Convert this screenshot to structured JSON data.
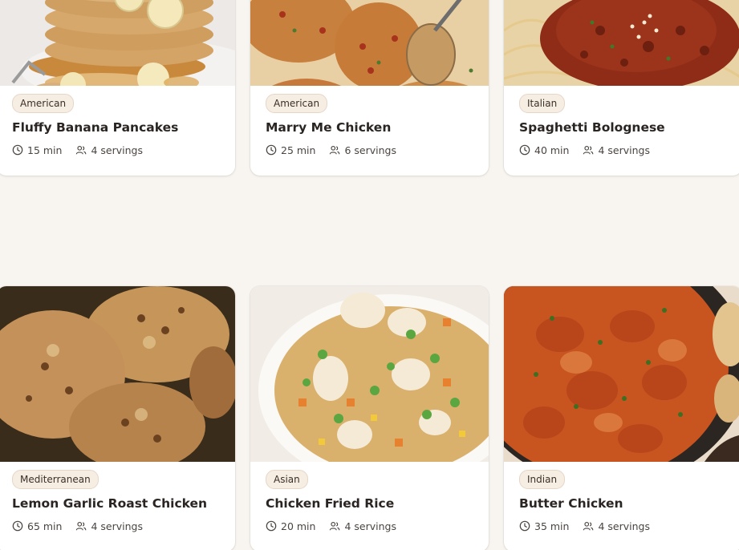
{
  "recipes": [
    {
      "cuisine": "American",
      "title": "Fluffy Banana Pancakes",
      "time": "15 min",
      "servings": "4 servings",
      "image": "banana-pancakes-photo"
    },
    {
      "cuisine": "American",
      "title": "Marry Me Chicken",
      "time": "25 min",
      "servings": "6 servings",
      "image": "marry-me-chicken-photo"
    },
    {
      "cuisine": "Italian",
      "title": "Spaghetti Bolognese",
      "time": "40 min",
      "servings": "4 servings",
      "image": "spaghetti-bolognese-photo"
    },
    {
      "cuisine": "Mediterranean",
      "title": "Lemon Garlic Roast Chicken",
      "time": "65 min",
      "servings": "4 servings",
      "image": "roast-chicken-photo"
    },
    {
      "cuisine": "Asian",
      "title": "Chicken Fried Rice",
      "time": "20 min",
      "servings": "4 servings",
      "image": "fried-rice-photo"
    },
    {
      "cuisine": "Indian",
      "title": "Butter Chicken",
      "time": "35 min",
      "servings": "4 servings",
      "image": "butter-chicken-photo"
    }
  ],
  "icons": {
    "time": "clock-icon",
    "servings": "users-icon"
  },
  "colors": {
    "page_bg": "#f8f5f1",
    "card_bg": "#ffffff",
    "tag_bg": "#f6ede3",
    "title_text": "#2a2522",
    "meta_text": "#4a4440"
  }
}
